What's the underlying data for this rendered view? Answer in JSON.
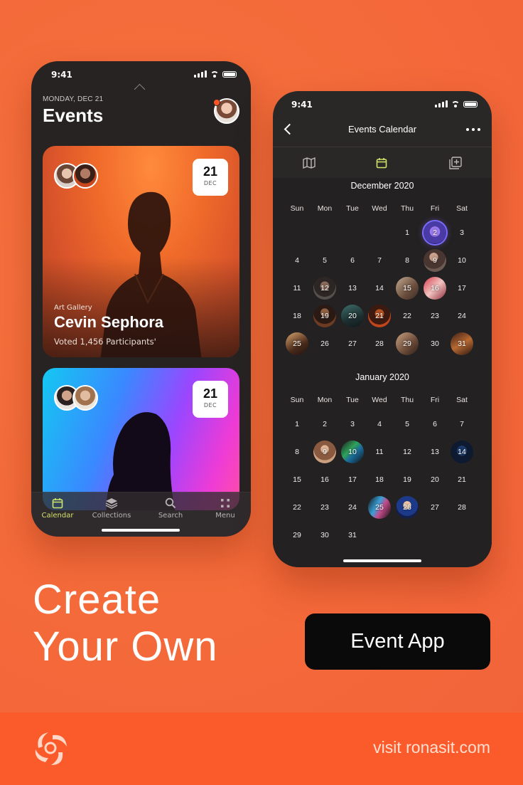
{
  "phone_left": {
    "status_time": "9:41",
    "date_label": "MONDAY, DEC 21",
    "title": "Events",
    "cards": [
      {
        "category": "Art Gallery",
        "name": "Cevin Sephora",
        "votes": "Voted 1,456 Participants'",
        "day": "21",
        "month": "DEC"
      },
      {
        "day": "21",
        "month": "DEC"
      }
    ],
    "tabs": [
      {
        "label": "Calendar",
        "icon": "calendar-icon",
        "active": true
      },
      {
        "label": "Collections",
        "icon": "layers-icon",
        "active": false
      },
      {
        "label": "Search",
        "icon": "search-icon",
        "active": false
      },
      {
        "label": "Menu",
        "icon": "grid-icon",
        "active": false
      }
    ]
  },
  "phone_right": {
    "status_time": "9:41",
    "title": "Events Calendar",
    "segments": [
      "map-icon",
      "calendar-icon",
      "add-collection-icon"
    ],
    "weekdays": [
      "Sun",
      "Mon",
      "Tue",
      "Wed",
      "Thu",
      "Fri",
      "Sat"
    ],
    "months": [
      {
        "title": "December 2020",
        "weeks": [
          [
            "",
            "",
            "",
            "",
            "1",
            "2",
            "3"
          ],
          [
            "4",
            "5",
            "6",
            "7",
            "8",
            "9",
            "10"
          ],
          [
            "11",
            "12",
            "13",
            "14",
            "15",
            "16",
            "17"
          ],
          [
            "18",
            "19",
            "20",
            "21",
            "22",
            "23",
            "24"
          ],
          [
            "25",
            "26",
            "27",
            "28",
            "29",
            "30",
            "31"
          ]
        ],
        "event_days": [
          "2",
          "9",
          "12",
          "15",
          "16",
          "19",
          "20",
          "21",
          "25",
          "29",
          "31"
        ],
        "selected_day": "2"
      },
      {
        "title": "January 2020",
        "weeks": [
          [
            "1",
            "2",
            "3",
            "4",
            "5",
            "6",
            "7"
          ],
          [
            "8",
            "9",
            "10",
            "11",
            "12",
            "13",
            "14"
          ],
          [
            "15",
            "16",
            "17",
            "18",
            "19",
            "20",
            "21"
          ],
          [
            "22",
            "23",
            "24",
            "25",
            "26",
            "27",
            "28"
          ],
          [
            "29",
            "30",
            "31",
            "",
            "",
            "",
            ""
          ]
        ],
        "event_days": [
          "9",
          "10",
          "14",
          "25",
          "26"
        ],
        "selected_day": ""
      }
    ]
  },
  "promo": {
    "headline_line1": "Create",
    "headline_line2": "Your Own",
    "cta": "Event App",
    "visit": "visit ronasit.com"
  },
  "colors": {
    "background": "#f4693a",
    "footer": "#fb5a2b",
    "accent": "#cfe56a",
    "phone": "#262322"
  }
}
